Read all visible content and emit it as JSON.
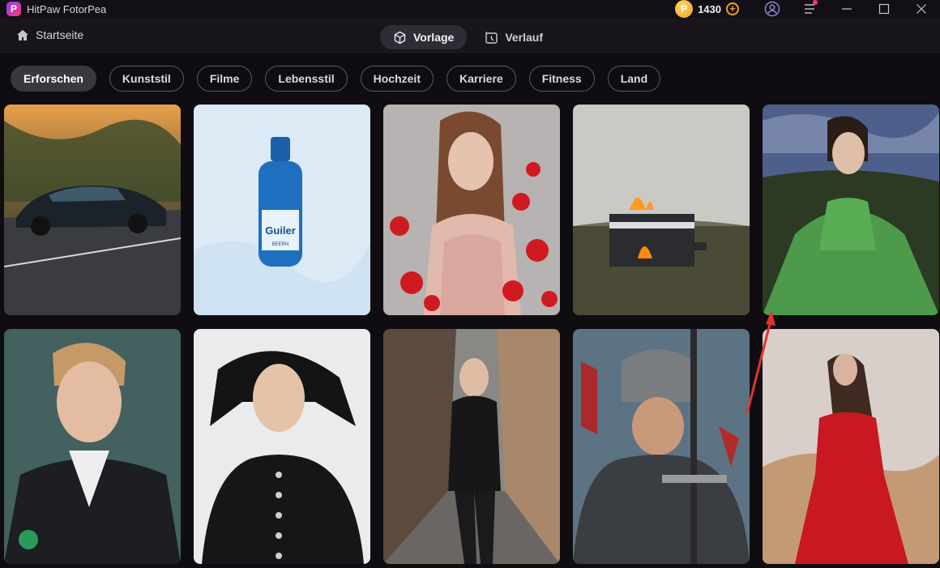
{
  "app": {
    "title": "HitPaw FotorPea",
    "credits": "1430",
    "logo_letter": "P"
  },
  "nav": {
    "home_label": "Startseite",
    "tabs": [
      {
        "label": "Vorlage",
        "icon": "cube-icon",
        "active": true
      },
      {
        "label": "Verlauf",
        "icon": "history-icon",
        "active": false
      }
    ]
  },
  "categories": [
    {
      "label": "Erforschen",
      "active": true
    },
    {
      "label": "Kunststil",
      "active": false
    },
    {
      "label": "Filme",
      "active": false
    },
    {
      "label": "Lebensstil",
      "active": false
    },
    {
      "label": "Hochzeit",
      "active": false
    },
    {
      "label": "Karriere",
      "active": false
    },
    {
      "label": "Fitness",
      "active": false
    },
    {
      "label": "Land",
      "active": false
    }
  ],
  "gallery_label_text": {
    "bottle_brand": "Guiler",
    "bottle_sub": "BEERN"
  },
  "colors": {
    "accent_coin": "#f0a21a",
    "annotation_arrow": "#e0332f",
    "notification_dot": "#ff3b5c"
  }
}
